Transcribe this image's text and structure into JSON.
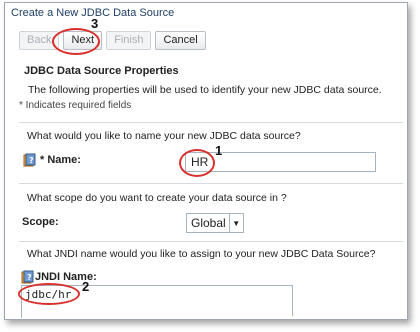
{
  "window": {
    "title": "Create a New JDBC Data Source"
  },
  "toolbar": {
    "back_label": "Back",
    "next_label": "Next",
    "finish_label": "Finish",
    "cancel_label": "Cancel"
  },
  "section": {
    "heading": "JDBC Data Source Properties",
    "description": "The following properties will be used to identify your new JDBC data source.",
    "required_note": "* Indicates required fields"
  },
  "name_field": {
    "question": "What would you like to name your new JDBC data source?",
    "label": "* Name:",
    "value": "HR"
  },
  "scope_field": {
    "question": "What scope do you want to create your data source in ?",
    "label": "Scope:",
    "selected": "Global"
  },
  "jndi_field": {
    "question": "What JNDI name would you like to assign to your new JDBC Data Source?",
    "label": "JNDI Name:",
    "value": "jdbc/hr"
  },
  "annotations": {
    "step1": "1",
    "step2": "2",
    "step3": "3"
  },
  "colors": {
    "annotation": "#d9302d",
    "title_text": "#1f3f66"
  },
  "icons": {
    "help": "help-book-icon"
  }
}
